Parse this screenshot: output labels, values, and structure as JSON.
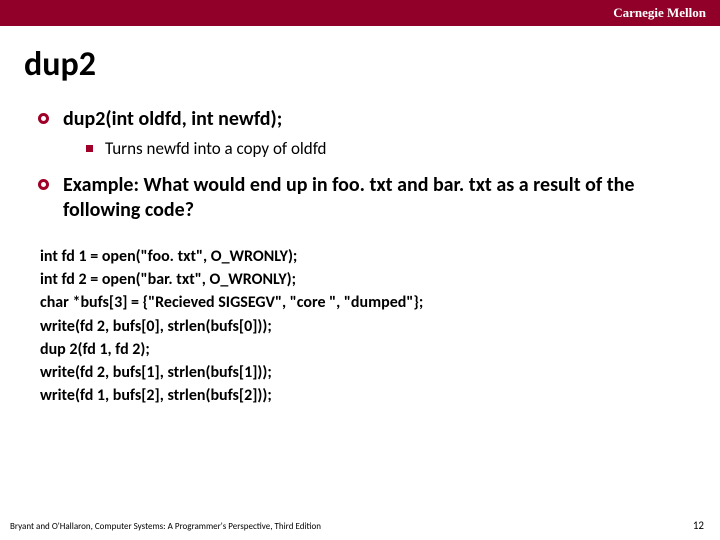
{
  "header": {
    "institution": "Carnegie Mellon"
  },
  "title": "dup2",
  "bullets": {
    "b1": "dup2(int oldfd, int newfd);",
    "b1_sub1": "Turns newfd into a copy of oldfd",
    "b2": "Example: What would end up in foo. txt and bar. txt as a result of the following code?"
  },
  "code": {
    "l1": "int fd 1 = open(\"foo. txt\", O_WRONLY);",
    "l2": "int fd 2 = open(\"bar. txt\", O_WRONLY);",
    "l3": "char *bufs[3] = {\"Recieved SIGSEGV\", \"core \", \"dumped\"};",
    "l4": "write(fd 2, bufs[0], strlen(bufs[0]));",
    "l5": "dup 2(fd 1, fd 2);",
    "l6": "write(fd 2, bufs[1], strlen(bufs[1]));",
    "l7": "write(fd 1, bufs[2], strlen(bufs[2]));"
  },
  "footer": {
    "citation": "Bryant and O'Hallaron, Computer Systems: A Programmer's Perspective, Third Edition",
    "page": "12"
  }
}
